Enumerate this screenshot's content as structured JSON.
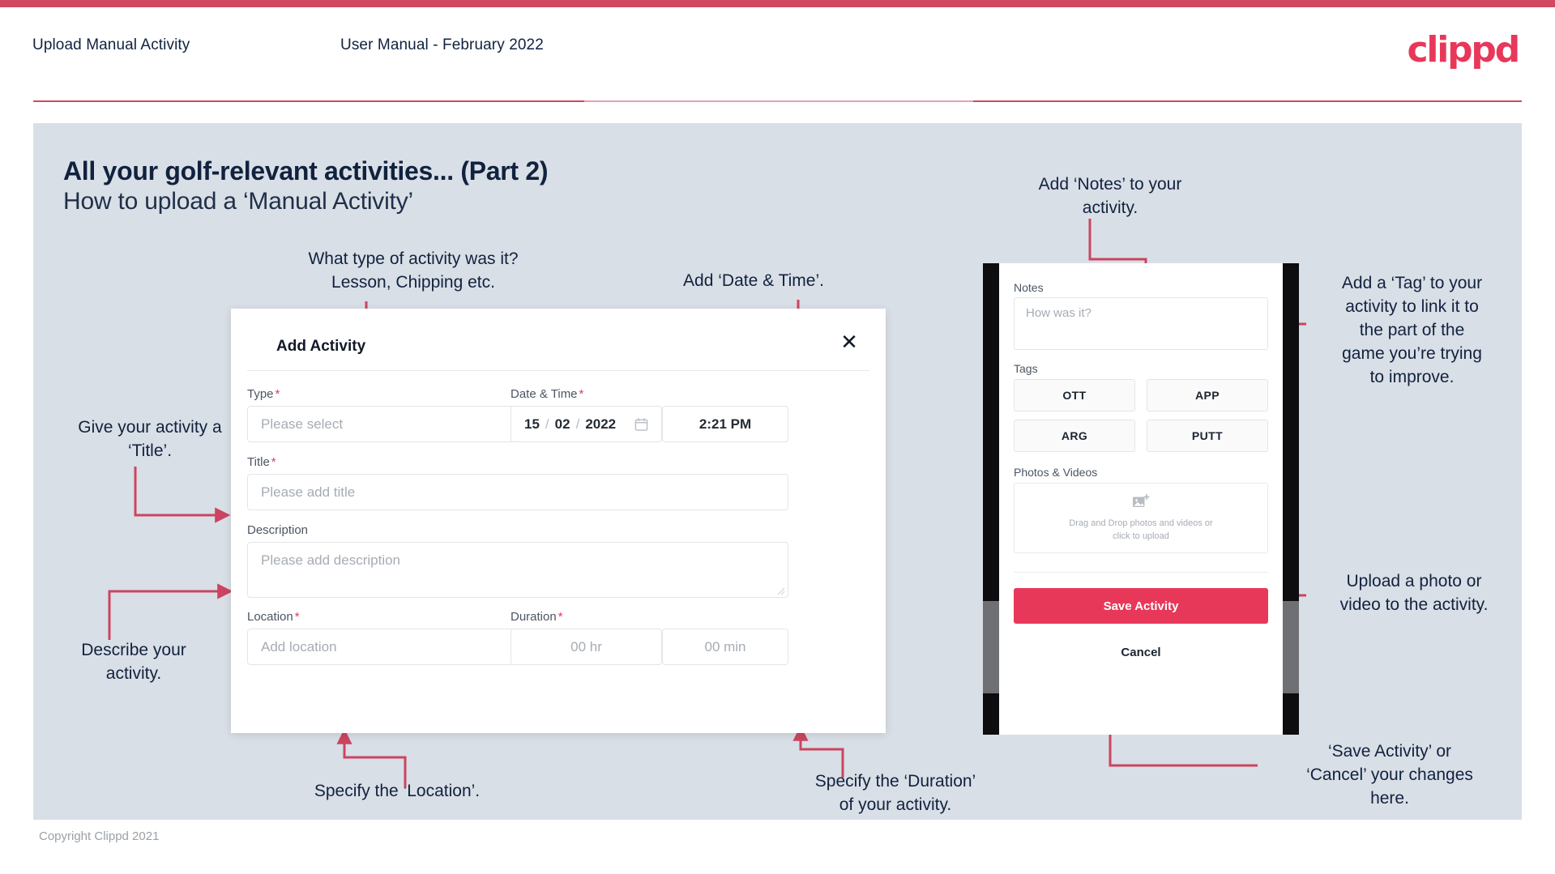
{
  "header": {
    "left_title": "Upload Manual Activity",
    "center_title": "User Manual - February 2022",
    "logo": "clippd",
    "accent_color": "#d04962"
  },
  "slide": {
    "title": "All your golf-relevant activities... (Part 2)",
    "subtitle": "How to upload a ‘Manual Activity’",
    "background_color": "#d9dfe6"
  },
  "footer": {
    "copyright": "Copyright Clippd 2021"
  },
  "dialog": {
    "title": "Add Activity",
    "close_icon": "close-icon",
    "fields": {
      "type": {
        "label": "Type",
        "required": true,
        "placeholder": "Please select",
        "icon": "chevron-down-icon"
      },
      "datetime": {
        "label": "Date & Time",
        "required": true,
        "day": "15",
        "month": "02",
        "year": "2022",
        "separator": "/",
        "icon": "calendar-icon",
        "time": "2:21 PM"
      },
      "title": {
        "label": "Title",
        "required": true,
        "placeholder": "Please add title"
      },
      "description": {
        "label": "Description",
        "required": false,
        "placeholder": "Please add description"
      },
      "location": {
        "label": "Location",
        "required": true,
        "placeholder": "Add location"
      },
      "duration": {
        "label": "Duration",
        "required": true,
        "hours_placeholder": "00 hr",
        "minutes_placeholder": "00 min"
      }
    }
  },
  "phone": {
    "notes": {
      "label": "Notes",
      "placeholder": "How was it?"
    },
    "tags": {
      "label": "Tags",
      "options": [
        "OTT",
        "APP",
        "ARG",
        "PUTT"
      ]
    },
    "photos": {
      "label": "Photos & Videos",
      "icon": "add-image-icon",
      "dropzone_line1": "Drag and Drop photos and videos or",
      "dropzone_line2": "click to upload"
    },
    "save_label": "Save Activity",
    "cancel_label": "Cancel",
    "save_color": "#e8385a"
  },
  "annotations": {
    "type": "What type of activity was it?\nLesson, Chipping etc.",
    "datetime": "Add ‘Date & Time’.",
    "title": "Give your activity a\n‘Title’.",
    "description": "Describe your\nactivity.",
    "location": "Specify the ‘Location’.",
    "duration": "Specify the ‘Duration’\nof your activity.",
    "notes": "Add ‘Notes’ to your\nactivity.",
    "tags": "Add a ‘Tag’ to your\nactivity to link it to\nthe part of the\ngame you’re trying\nto improve.",
    "photos": "Upload a photo or\nvideo to the activity.",
    "save": "‘Save Activity’ or\n‘Cancel’ your changes\nhere.",
    "arrow_color": "#cb4560"
  }
}
